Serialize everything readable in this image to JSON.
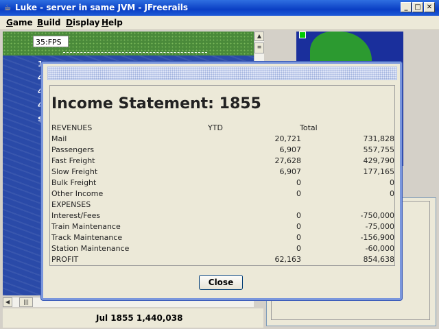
{
  "window": {
    "title": "Luke - server in same JVM - JFreerails",
    "controls": {
      "minimize": "_",
      "maximize": "□",
      "close": "✕"
    }
  },
  "menubar": {
    "items": [
      {
        "label": "Game",
        "underline": "G"
      },
      {
        "label": "Build",
        "underline": "B"
      },
      {
        "label": "Display",
        "underline": "D"
      },
      {
        "label": "Help",
        "underline": "H"
      }
    ]
  },
  "map": {
    "fps": "35:FPS",
    "side_numbers": [
      "1",
      "4",
      "4",
      "4",
      "$"
    ]
  },
  "statusbar": {
    "text": "Jul 1855  1,440,038"
  },
  "dialog": {
    "heading": "Income Statement: 1855",
    "columns": {
      "section": "REVENUES",
      "ytd": "YTD",
      "total": "Total"
    },
    "revenues": [
      {
        "label": "Mail",
        "ytd": "20,721",
        "total": "731,828"
      },
      {
        "label": "Passengers",
        "ytd": "6,907",
        "total": "557,755"
      },
      {
        "label": "Fast Freight",
        "ytd": "27,628",
        "total": "429,790"
      },
      {
        "label": "Slow Freight",
        "ytd": "6,907",
        "total": "177,165"
      },
      {
        "label": "Bulk Freight",
        "ytd": "0",
        "total": "0"
      },
      {
        "label": "Other Income",
        "ytd": "0",
        "total": "0"
      }
    ],
    "expenses_label": "EXPENSES",
    "expenses": [
      {
        "label": "Interest/Fees",
        "ytd": "0",
        "total": "-750,000"
      },
      {
        "label": "Train Maintenance",
        "ytd": "0",
        "total": "-75,000"
      },
      {
        "label": "Track Maintenance",
        "ytd": "0",
        "total": "-156,900"
      },
      {
        "label": "Station Maintenance",
        "ytd": "0",
        "total": "-60,000"
      }
    ],
    "profit": {
      "label": "PROFIT",
      "ytd": "62,163",
      "total": "854,638"
    },
    "close_label": "Close"
  },
  "colors": {
    "titlebar": "#0a3fc4",
    "sea": "#2a4aa8",
    "land": "#4a8a3a",
    "dialog_border": "#7a96dc"
  },
  "icons": {
    "app": "java-coffee-cup-icon"
  }
}
